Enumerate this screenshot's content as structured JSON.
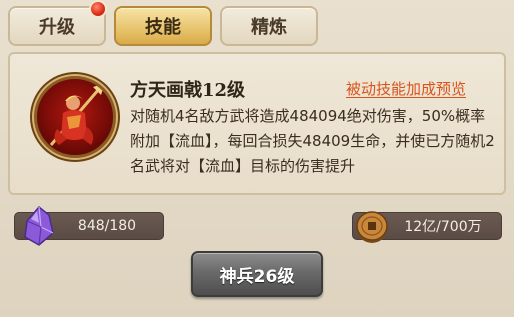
{
  "tabs": [
    {
      "label": "升级",
      "active": false,
      "badge": true
    },
    {
      "label": "技能",
      "active": true,
      "badge": false
    },
    {
      "label": "精炼",
      "active": false,
      "badge": false
    }
  ],
  "skill": {
    "name": "方天画戟12级",
    "preview_link": "被动技能加成预览",
    "description": "对随机4名敌方武将造成484094绝对伤害，50%概率附加【流血】，每回合损失48409生命，并使已方随机2名武将对【流血】目标的伤害提升",
    "icon": "halberd-warrior-icon"
  },
  "resources": {
    "gem": {
      "value": "848/180",
      "icon": "purple-crystal-icon"
    },
    "coin": {
      "value": "12亿/700万",
      "icon": "copper-coin-icon"
    }
  },
  "main_button": {
    "label": "神兵26级"
  },
  "colors": {
    "active_tab": "#e6c36c",
    "link": "#d9531a",
    "badge": "#e0301e"
  }
}
